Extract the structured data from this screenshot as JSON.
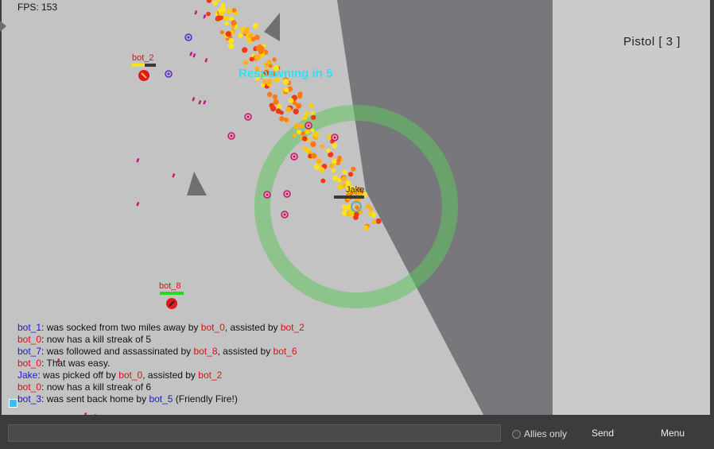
{
  "hud": {
    "fps": "FPS: 153",
    "weapon": "Pistol  [ 3 ]",
    "respawn": "Respawning in 5"
  },
  "players": {
    "bot_2": "bot_2",
    "bot_8": "bot_8",
    "jake": "Jake"
  },
  "kill_feed": [
    [
      {
        "t": "bot_1",
        "c": "blue"
      },
      {
        "t": ":  was socked from two miles away by ",
        "c": ""
      },
      {
        "t": "bot_0",
        "c": "red"
      },
      {
        "t": ", assisted by ",
        "c": ""
      },
      {
        "t": "bot_2",
        "c": "red"
      }
    ],
    [
      {
        "t": "bot_0",
        "c": "red"
      },
      {
        "t": ": now has a kill streak of 5",
        "c": ""
      }
    ],
    [
      {
        "t": "bot_7",
        "c": "blue"
      },
      {
        "t": ":  was followed and assassinated by ",
        "c": ""
      },
      {
        "t": "bot_8",
        "c": "red"
      },
      {
        "t": ", assisted by ",
        "c": ""
      },
      {
        "t": "bot_6",
        "c": "red"
      }
    ],
    [
      {
        "t": "bot_0",
        "c": "red"
      },
      {
        "t": ": That was easy.",
        "c": ""
      }
    ],
    [
      {
        "t": "Jake",
        "c": "blue"
      },
      {
        "t": ":  was picked off by ",
        "c": ""
      },
      {
        "t": "bot_0",
        "c": "red"
      },
      {
        "t": ", assisted by ",
        "c": ""
      },
      {
        "t": "bot_2",
        "c": "red"
      }
    ],
    [
      {
        "t": "bot_0",
        "c": "red"
      },
      {
        "t": ": now has a kill streak of 6",
        "c": ""
      }
    ],
    [
      {
        "t": "bot_3",
        "c": "blue"
      },
      {
        "t": ":  was sent back home by ",
        "c": ""
      },
      {
        "t": "bot_5",
        "c": "blue"
      },
      {
        "t": " (Friendly Fire!)",
        "c": ""
      }
    ]
  ],
  "bottom_bar": {
    "chat_value": "",
    "allies_label": "Allies only",
    "send_label": "Send",
    "menu_label": "Menu"
  },
  "colors": {
    "floor": "#c3c3c3",
    "wall": "#7a7a7e",
    "zone_ring": "#5fc55f",
    "team_blue": "#1a1acc",
    "team_red": "#d41414",
    "respawn_text": "#33e0f0"
  }
}
